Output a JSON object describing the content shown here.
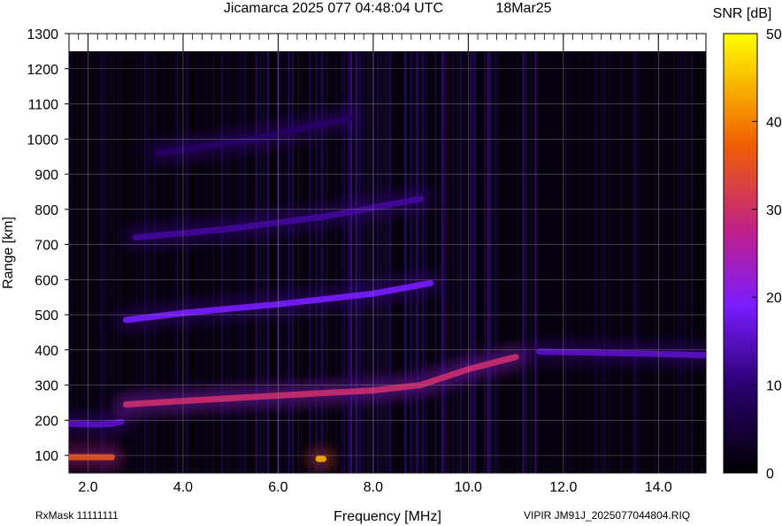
{
  "chart_data": {
    "type": "heatmap",
    "title": "Jicamarca 2025 077 04:48:04 UTC",
    "date_label": "18Mar25",
    "xlabel": "Frequency [MHz]",
    "ylabel": "Range [km]",
    "xlim": [
      1.6,
      15.0
    ],
    "ylim": [
      50,
      1300
    ],
    "x_ticks": [
      "2.0",
      "4.0",
      "6.0",
      "8.0",
      "10.0",
      "12.0",
      "14.0"
    ],
    "y_ticks": [
      "100",
      "200",
      "300",
      "400",
      "500",
      "600",
      "700",
      "800",
      "900",
      "1000",
      "1100",
      "1200",
      "1300"
    ],
    "colorbar": {
      "label": "SNR [dB]",
      "range": [
        0,
        50
      ],
      "ticks": [
        "0",
        "10",
        "20",
        "30",
        "40",
        "50"
      ],
      "colors": [
        "#000000",
        "#2a0070",
        "#7a1cff",
        "#c0208a",
        "#f06000",
        "#ffff00"
      ]
    },
    "traces": [
      {
        "x": [
          1.6,
          2.2,
          2.5,
          2.7
        ],
        "y": [
          190,
          188,
          190,
          196
        ],
        "snr": 16
      },
      {
        "x": [
          2.8,
          4.0,
          6.0,
          8.0,
          9.0,
          10.0,
          11.0
        ],
        "y": [
          245,
          255,
          270,
          285,
          300,
          345,
          380
        ],
        "snr": 32
      },
      {
        "x": [
          11.5,
          12.5,
          13.5,
          15.0
        ],
        "y": [
          395,
          393,
          390,
          385
        ],
        "snr": 16
      },
      {
        "x": [
          2.8,
          4.0,
          6.0,
          8.0,
          9.2
        ],
        "y": [
          485,
          505,
          530,
          560,
          590
        ],
        "snr": 20
      },
      {
        "x": [
          3.0,
          5.0,
          7.0,
          9.0
        ],
        "y": [
          720,
          745,
          780,
          830
        ],
        "snr": 13
      },
      {
        "x": [
          3.5,
          5.5,
          7.5
        ],
        "y": [
          960,
          1000,
          1060
        ],
        "snr": 9
      },
      {
        "x": [
          1.6,
          2.5
        ],
        "y": [
          95,
          95
        ],
        "snr": 38
      },
      {
        "x": [
          6.85,
          6.95
        ],
        "y": [
          90,
          90
        ],
        "snr": 45
      }
    ]
  },
  "footer": {
    "rxmask": "RxMask 11111111",
    "filename": "VIPIR  JM91J_2025077044804.RIQ"
  }
}
